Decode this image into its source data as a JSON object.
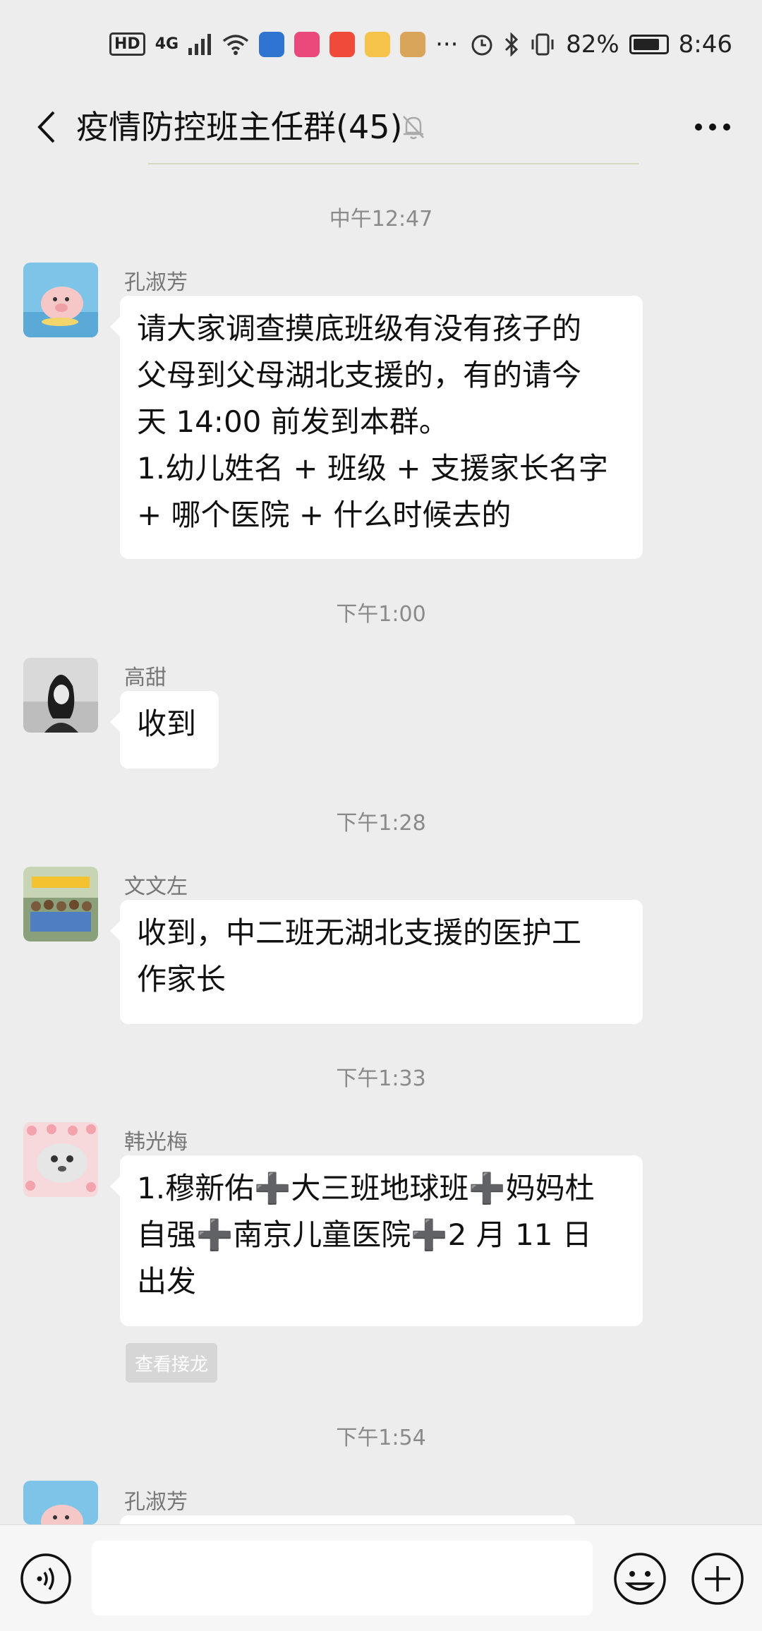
{
  "status_bar": {
    "left_badge": "HD",
    "network": "4G",
    "more": "···",
    "battery_percent": "82%",
    "battery_level": 0.82,
    "time": "8:46"
  },
  "header": {
    "title": "疫情防控班主任群(45)",
    "back_icon": "chevron-left-icon",
    "mute_icon": "bell-off-icon",
    "more_icon": "more-dots-icon"
  },
  "messages": [
    {
      "time": "中午12:47",
      "sender": "孔淑芳",
      "lines": [
        "请大家调查摸底班级有没有孩子的",
        "父母到父母湖北支援的，有的请今",
        "天 14:00 前发到本群。",
        "1.幼儿姓名 + 班级 + 支援家长名字",
        "+ 哪个医院 + 什么时候去的"
      ]
    },
    {
      "time": "下午1:00",
      "sender": "高甜",
      "lines": [
        "收到"
      ]
    },
    {
      "time": "下午1:28",
      "sender": "文文左",
      "lines": [
        "收到，中二班无湖北支援的医护工",
        "作家长"
      ]
    },
    {
      "time": "下午1:33",
      "sender": "韩光梅",
      "lines": [
        "1.穆新佑➕大三班地球班➕妈妈杜",
        "自强➕南京儿童医院➕2 月 11 日",
        "出发"
      ],
      "action": "查看接龙"
    },
    {
      "time": "下午1:54",
      "sender": "孔淑芳",
      "lines": []
    }
  ],
  "input_bar": {
    "voice_icon": "voice-icon",
    "emoji_icon": "emoji-icon",
    "plus_icon": "plus-icon",
    "input_value": ""
  },
  "colors": {
    "background": "#ededed",
    "bubble": "#ffffff",
    "timestamp": "#8a8a8a"
  }
}
